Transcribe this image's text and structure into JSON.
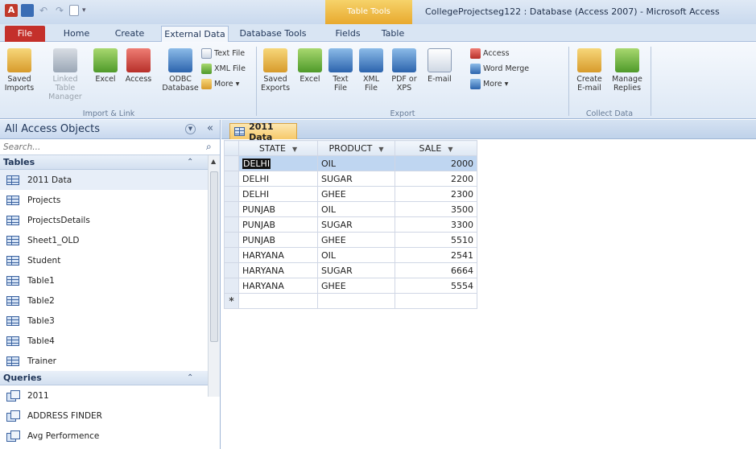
{
  "titlebar": {
    "window_title": "CollegeProjectseg122 : Database (Access 2007)  -  Microsoft Access",
    "contextual_title": "Table Tools",
    "app_icon_letter": "A"
  },
  "tabs": {
    "file": "File",
    "home": "Home",
    "create": "Create",
    "external": "External Data",
    "dbtools": "Database Tools",
    "fields": "Fields",
    "table": "Table",
    "active": "External Data"
  },
  "ribbon": {
    "import_link": {
      "label": "Import & Link",
      "saved_imports": "Saved Imports",
      "linked_table_manager": "Linked Table Manager",
      "excel": "Excel",
      "access": "Access",
      "odbc": "ODBC Database",
      "text_file": "Text File",
      "xml_file": "XML File",
      "more": "More ▾"
    },
    "export": {
      "label": "Export",
      "saved_exports": "Saved Exports",
      "excel": "Excel",
      "text_file": "Text File",
      "xml_file": "XML File",
      "pdf_xps": "PDF or XPS",
      "email": "E-mail",
      "access": "Access",
      "word_merge": "Word Merge",
      "more": "More ▾"
    },
    "collect": {
      "label": "Collect Data",
      "create_email": "Create E-mail",
      "manage_replies": "Manage Replies"
    }
  },
  "nav": {
    "title": "All Access Objects",
    "search_placeholder": "Search...",
    "groups": [
      {
        "name": "Tables",
        "items": [
          "2011 Data",
          "Projects",
          "ProjectsDetails",
          "Sheet1_OLD",
          "Student",
          "Table1",
          "Table2",
          "Table3",
          "Table4",
          "Trainer"
        ]
      },
      {
        "name": "Queries",
        "items": [
          "2011",
          "ADDRESS FINDER",
          "Avg Performence"
        ]
      }
    ]
  },
  "document": {
    "tab_label": "2011 Data",
    "columns": [
      "STATE",
      "PRODUCT",
      "SALE"
    ],
    "rows": [
      [
        "DELHI",
        "OIL",
        "2000"
      ],
      [
        "DELHI",
        "SUGAR",
        "2200"
      ],
      [
        "DELHI",
        "GHEE",
        "2300"
      ],
      [
        "PUNJAB",
        "OIL",
        "3500"
      ],
      [
        "PUNJAB",
        "SUGAR",
        "3300"
      ],
      [
        "PUNJAB",
        "GHEE",
        "5510"
      ],
      [
        "HARYANA",
        "OIL",
        "2541"
      ],
      [
        "HARYANA",
        "SUGAR",
        "6664"
      ],
      [
        "HARYANA",
        "GHEE",
        "5554"
      ]
    ],
    "new_row_marker": "*"
  }
}
